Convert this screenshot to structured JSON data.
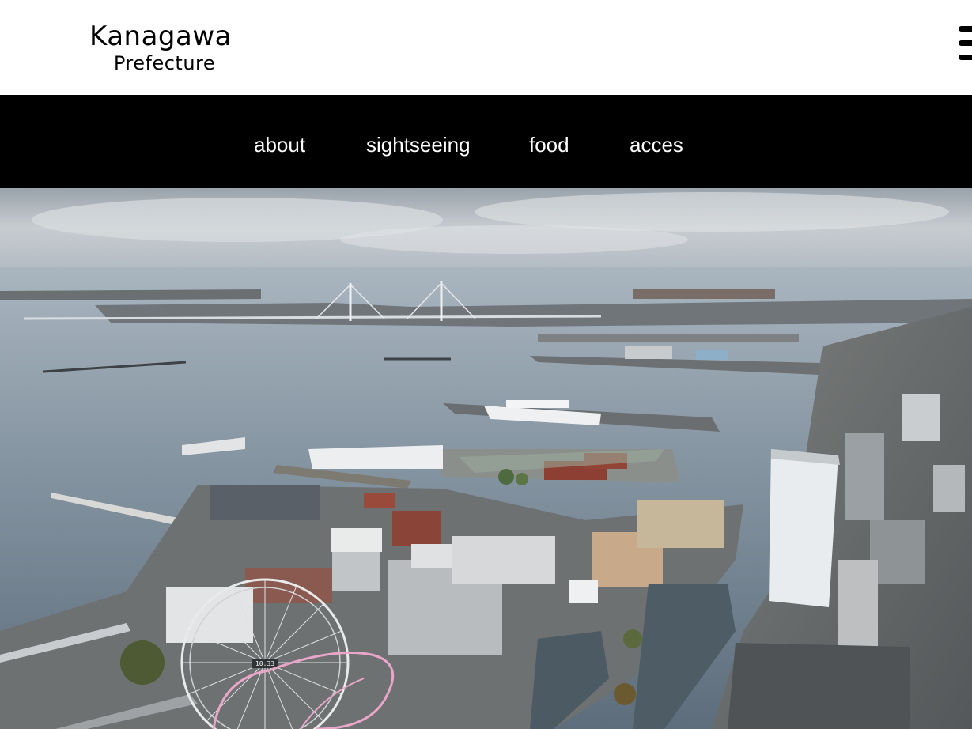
{
  "logo": {
    "line1": "Kanagawa",
    "line2": "Prefecture"
  },
  "nav": {
    "items": [
      {
        "label": "about"
      },
      {
        "label": "sightseeing"
      },
      {
        "label": "food"
      },
      {
        "label": "acces"
      }
    ]
  },
  "menu": {
    "icon": "hamburger-menu-icon"
  },
  "hero": {
    "subject": "Aerial view of Yokohama harbour with ferris wheel, bay bridge and port",
    "ferris_wheel_clock": "10:33"
  },
  "colors": {
    "nav_background": "#000000",
    "nav_text": "#ffffff",
    "header_background": "#ffffff"
  }
}
